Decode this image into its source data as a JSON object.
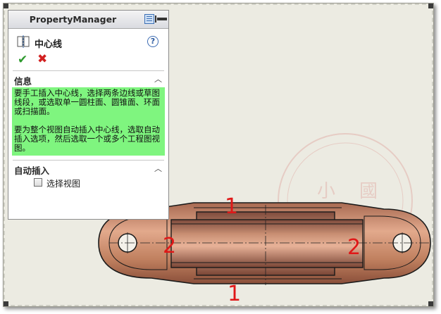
{
  "panel": {
    "title": "PropertyManager",
    "feature_title": "中心线",
    "help": "?",
    "ok": "✔",
    "cancel": "✖",
    "info_group": {
      "title": "信息",
      "paragraph1": "要手工插入中心线，选择两条边线或草图线段，或选取单一圆柱面、圆锥面、环面或扫描面。",
      "paragraph2": "要为整个视图自动插入中心线，选取自动插入选项，然后选取一个或多个工程图视图。"
    },
    "auto_group": {
      "title": "自动插入",
      "option_label": "选择视图",
      "option_checked": false
    }
  },
  "drawing": {
    "annotations": [
      "1",
      "2",
      "2",
      "1"
    ],
    "watermark": [
      "小",
      "國",
      "小"
    ],
    "colors": {
      "canvas": "#ecebe2",
      "part_body": "#c88a6a",
      "info_box": "#7ff57f",
      "annotation": "#e01818"
    }
  }
}
